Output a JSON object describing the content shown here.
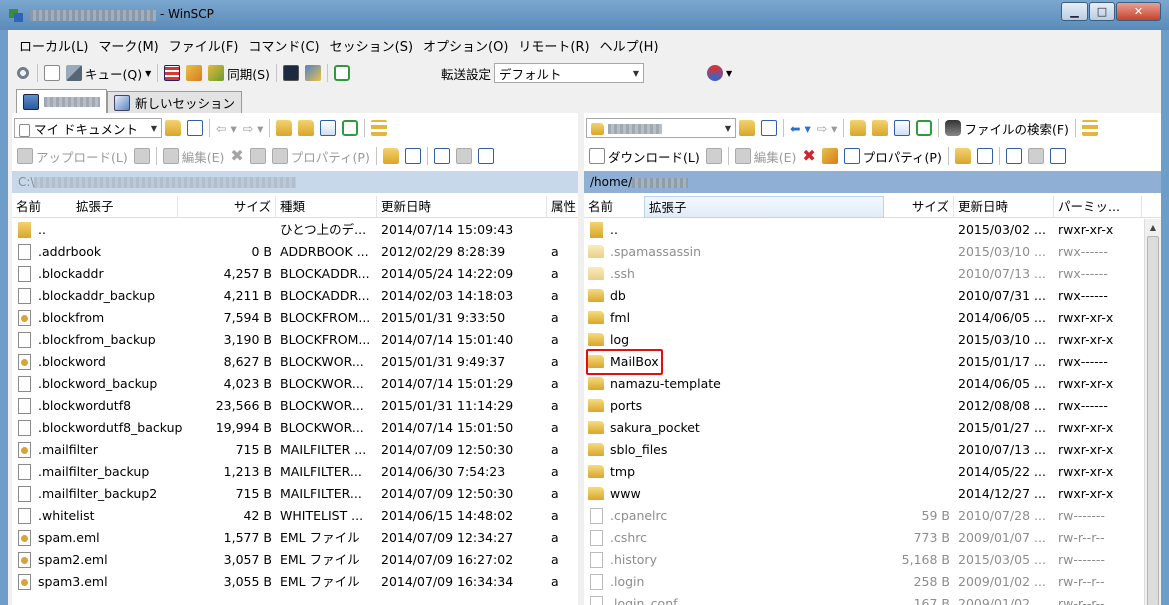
{
  "window": {
    "title": "- WinSCP",
    "minimize": "▁",
    "maximize": "□",
    "close": "✕"
  },
  "menu": [
    "ローカル(L)",
    "マーク(M)",
    "ファイル(F)",
    "コマンド(C)",
    "セッション(S)",
    "オプション(O)",
    "リモート(R)",
    "ヘルプ(H)"
  ],
  "toolbar": {
    "queue_label": "キュー(Q)",
    "sync_label": "同期(S)",
    "transfer_label": "転送設定",
    "transfer_value": "デフォルト"
  },
  "tabs": {
    "new_session": "新しいセッション"
  },
  "local": {
    "location": "マイ ドキュメント",
    "upload": "アップロード(L)",
    "edit": "編集(E)",
    "properties": "プロパティ(P)",
    "path": "C:\\",
    "columns": [
      "名前",
      "拡張子",
      "サイズ",
      "種類",
      "更新日時",
      "属性"
    ],
    "files": [
      {
        "name": "..",
        "size": "",
        "type": "ひとつ上のデ...",
        "date": "2014/07/14 15:09:43",
        "attr": "",
        "icon": "up"
      },
      {
        "name": ".addrbook",
        "size": "0 B",
        "type": "ADDRBOOK ...",
        "date": "2012/02/29  8:28:39",
        "attr": "a",
        "icon": "file"
      },
      {
        "name": ".blockaddr",
        "size": "4,257 B",
        "type": "BLOCKADDR...",
        "date": "2014/05/24 14:22:09",
        "attr": "a",
        "icon": "file"
      },
      {
        "name": ".blockaddr_backup",
        "size": "4,211 B",
        "type": "BLOCKADDR...",
        "date": "2014/02/03 14:18:03",
        "attr": "a",
        "icon": "file"
      },
      {
        "name": ".blockfrom",
        "size": "7,594 B",
        "type": "BLOCKFROM...",
        "date": "2015/01/31  9:33:50",
        "attr": "a",
        "icon": "txt"
      },
      {
        "name": ".blockfrom_backup",
        "size": "3,190 B",
        "type": "BLOCKFROM...",
        "date": "2014/07/14 15:01:40",
        "attr": "a",
        "icon": "file"
      },
      {
        "name": ".blockword",
        "size": "8,627 B",
        "type": "BLOCKWOR...",
        "date": "2015/01/31  9:49:37",
        "attr": "a",
        "icon": "txt"
      },
      {
        "name": ".blockword_backup",
        "size": "4,023 B",
        "type": "BLOCKWOR...",
        "date": "2014/07/14 15:01:29",
        "attr": "a",
        "icon": "file"
      },
      {
        "name": ".blockwordutf8",
        "size": "23,566 B",
        "type": "BLOCKWOR...",
        "date": "2015/01/31 11:14:29",
        "attr": "a",
        "icon": "file"
      },
      {
        "name": ".blockwordutf8_backup",
        "size": "19,994 B",
        "type": "BLOCKWOR...",
        "date": "2014/07/14 15:01:50",
        "attr": "a",
        "icon": "file"
      },
      {
        "name": ".mailfilter",
        "size": "715 B",
        "type": "MAILFILTER ...",
        "date": "2014/07/09 12:50:30",
        "attr": "a",
        "icon": "txt"
      },
      {
        "name": ".mailfilter_backup",
        "size": "1,213 B",
        "type": "MAILFILTER...",
        "date": "2014/06/30  7:54:23",
        "attr": "a",
        "icon": "file"
      },
      {
        "name": ".mailfilter_backup2",
        "size": "715 B",
        "type": "MAILFILTER...",
        "date": "2014/07/09 12:50:30",
        "attr": "a",
        "icon": "file"
      },
      {
        "name": ".whitelist",
        "size": "42 B",
        "type": "WHITELIST ...",
        "date": "2014/06/15 14:48:02",
        "attr": "a",
        "icon": "file"
      },
      {
        "name": "spam.eml",
        "size": "1,577 B",
        "type": "EML ファイル",
        "date": "2014/07/09 12:34:27",
        "attr": "a",
        "icon": "txt"
      },
      {
        "name": "spam2.eml",
        "size": "3,057 B",
        "type": "EML ファイル",
        "date": "2014/07/09 16:27:02",
        "attr": "a",
        "icon": "txt"
      },
      {
        "name": "spam3.eml",
        "size": "3,055 B",
        "type": "EML ファイル",
        "date": "2014/07/09 16:34:34",
        "attr": "a",
        "icon": "txt"
      }
    ]
  },
  "remote": {
    "download": "ダウンロード(L)",
    "edit": "編集(E)",
    "properties": "プロパティ(P)",
    "find": "ファイルの検索(F)",
    "path": "/home/",
    "columns": [
      "名前",
      "拡張子",
      "サイズ",
      "更新日時",
      "パーミッ..."
    ],
    "files": [
      {
        "name": "..",
        "size": "",
        "date": "2015/03/02 ...",
        "perm": "rwxr-xr-x",
        "icon": "up",
        "hidden": false
      },
      {
        "name": ".spamassassin",
        "size": "",
        "date": "2015/03/10 ...",
        "perm": "rwx------",
        "icon": "folder",
        "hidden": true
      },
      {
        "name": ".ssh",
        "size": "",
        "date": "2010/07/13 ...",
        "perm": "rwx------",
        "icon": "folder",
        "hidden": true
      },
      {
        "name": "db",
        "size": "",
        "date": "2010/07/31 ...",
        "perm": "rwx------",
        "icon": "folder",
        "hidden": false
      },
      {
        "name": "fml",
        "size": "",
        "date": "2014/06/05 ...",
        "perm": "rwxr-xr-x",
        "icon": "folder",
        "hidden": false
      },
      {
        "name": "log",
        "size": "",
        "date": "2015/03/10 ...",
        "perm": "rwxr-xr-x",
        "icon": "folder",
        "hidden": false
      },
      {
        "name": "MailBox",
        "size": "",
        "date": "2015/01/17 ...",
        "perm": "rwx------",
        "icon": "folder",
        "hidden": false
      },
      {
        "name": "namazu-template",
        "size": "",
        "date": "2014/06/05 ...",
        "perm": "rwxr-xr-x",
        "icon": "folder",
        "hidden": false
      },
      {
        "name": "ports",
        "size": "",
        "date": "2012/08/08 ...",
        "perm": "rwx------",
        "icon": "folder",
        "hidden": false
      },
      {
        "name": "sakura_pocket",
        "size": "",
        "date": "2015/01/27 ...",
        "perm": "rwxr-xr-x",
        "icon": "folder",
        "hidden": false
      },
      {
        "name": "sblo_files",
        "size": "",
        "date": "2010/07/13 ...",
        "perm": "rwxr-xr-x",
        "icon": "folder",
        "hidden": false
      },
      {
        "name": "tmp",
        "size": "",
        "date": "2014/05/22 ...",
        "perm": "rwxr-xr-x",
        "icon": "folder",
        "hidden": false
      },
      {
        "name": "www",
        "size": "",
        "date": "2014/12/27 ...",
        "perm": "rwxr-xr-x",
        "icon": "folder",
        "hidden": false
      },
      {
        "name": ".cpanelrc",
        "size": "59 B",
        "date": "2010/07/28 ...",
        "perm": "rw-------",
        "icon": "file",
        "hidden": true
      },
      {
        "name": ".cshrc",
        "size": "773 B",
        "date": "2009/01/07 ...",
        "perm": "rw-r--r--",
        "icon": "file",
        "hidden": true
      },
      {
        "name": ".history",
        "size": "5,168 B",
        "date": "2015/03/05 ...",
        "perm": "rw-------",
        "icon": "file",
        "hidden": true
      },
      {
        "name": ".login",
        "size": "258 B",
        "date": "2009/01/02 ...",
        "perm": "rw-r--r--",
        "icon": "file",
        "hidden": true
      },
      {
        "name": ".login_conf",
        "size": "167 B",
        "date": "2009/01/02 ...",
        "perm": "rw-r--r--",
        "icon": "file",
        "hidden": true
      }
    ]
  }
}
